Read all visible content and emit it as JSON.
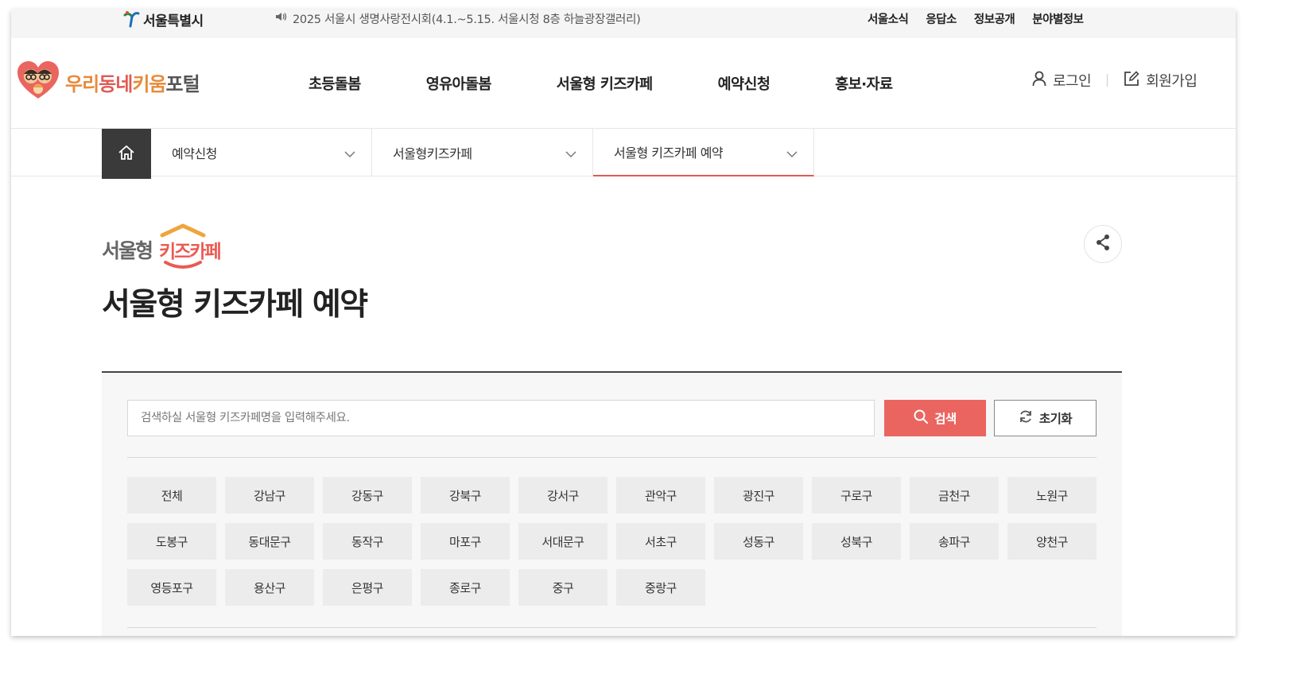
{
  "topbar": {
    "seoul_logo": "서울특별시",
    "notice": "2025 서울시 생명사랑전시회(4.1.~5.15. 서울시청 8층 하늘광장갤러리)",
    "links": [
      "서울소식",
      "응답소",
      "정보공개",
      "분야별정보"
    ]
  },
  "header": {
    "brand": {
      "part1": "우리",
      "part2": "동네",
      "part3": "키움",
      "part4": "포털"
    },
    "nav": [
      "초등돌봄",
      "영유아돌봄",
      "서울형 키즈카페",
      "예약신청",
      "홍보·자료"
    ],
    "login": "로그인",
    "signup": "회원가입"
  },
  "breadcrumb": {
    "level1": "예약신청",
    "level2": "서울형키즈카페",
    "level3": "서울형 키즈카페 예약"
  },
  "page": {
    "logo_text": {
      "left": "서울형",
      "right": "키즈카페"
    },
    "title": "서울형 키즈카페 예약"
  },
  "search": {
    "placeholder": "검색하실 서울형 키즈카페명을 입력해주세요.",
    "search_label": "검색",
    "reset_label": "초기화"
  },
  "districts": [
    "전체",
    "강남구",
    "강동구",
    "강북구",
    "강서구",
    "관악구",
    "광진구",
    "구로구",
    "금천구",
    "노원구",
    "도봉구",
    "동대문구",
    "동작구",
    "마포구",
    "서대문구",
    "서초구",
    "성동구",
    "성북구",
    "송파구",
    "양천구",
    "영등포구",
    "용산구",
    "은평구",
    "종로구",
    "중구",
    "중랑구"
  ],
  "colors": {
    "accent": "#ea6560",
    "dark": "#3a3a3a",
    "chip_bg": "#ececec"
  }
}
